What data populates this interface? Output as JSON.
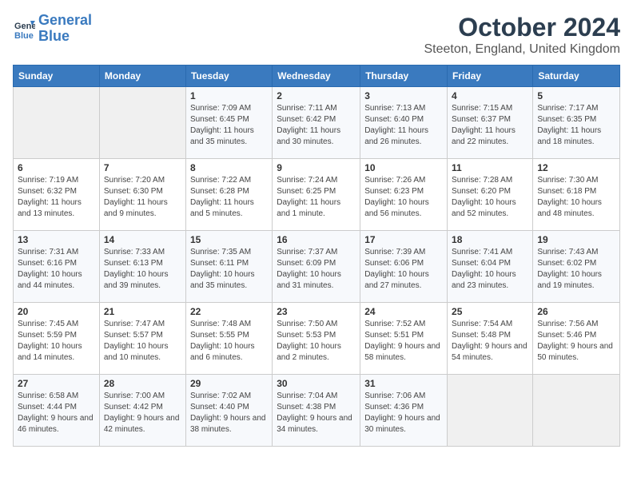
{
  "header": {
    "logo_line1": "General",
    "logo_line2": "Blue",
    "month_title": "October 2024",
    "subtitle": "Steeton, England, United Kingdom"
  },
  "days_of_week": [
    "Sunday",
    "Monday",
    "Tuesday",
    "Wednesday",
    "Thursday",
    "Friday",
    "Saturday"
  ],
  "weeks": [
    [
      {
        "day": "",
        "info": ""
      },
      {
        "day": "",
        "info": ""
      },
      {
        "day": "1",
        "info": "Sunrise: 7:09 AM\nSunset: 6:45 PM\nDaylight: 11 hours and 35 minutes."
      },
      {
        "day": "2",
        "info": "Sunrise: 7:11 AM\nSunset: 6:42 PM\nDaylight: 11 hours and 30 minutes."
      },
      {
        "day": "3",
        "info": "Sunrise: 7:13 AM\nSunset: 6:40 PM\nDaylight: 11 hours and 26 minutes."
      },
      {
        "day": "4",
        "info": "Sunrise: 7:15 AM\nSunset: 6:37 PM\nDaylight: 11 hours and 22 minutes."
      },
      {
        "day": "5",
        "info": "Sunrise: 7:17 AM\nSunset: 6:35 PM\nDaylight: 11 hours and 18 minutes."
      }
    ],
    [
      {
        "day": "6",
        "info": "Sunrise: 7:19 AM\nSunset: 6:32 PM\nDaylight: 11 hours and 13 minutes."
      },
      {
        "day": "7",
        "info": "Sunrise: 7:20 AM\nSunset: 6:30 PM\nDaylight: 11 hours and 9 minutes."
      },
      {
        "day": "8",
        "info": "Sunrise: 7:22 AM\nSunset: 6:28 PM\nDaylight: 11 hours and 5 minutes."
      },
      {
        "day": "9",
        "info": "Sunrise: 7:24 AM\nSunset: 6:25 PM\nDaylight: 11 hours and 1 minute."
      },
      {
        "day": "10",
        "info": "Sunrise: 7:26 AM\nSunset: 6:23 PM\nDaylight: 10 hours and 56 minutes."
      },
      {
        "day": "11",
        "info": "Sunrise: 7:28 AM\nSunset: 6:20 PM\nDaylight: 10 hours and 52 minutes."
      },
      {
        "day": "12",
        "info": "Sunrise: 7:30 AM\nSunset: 6:18 PM\nDaylight: 10 hours and 48 minutes."
      }
    ],
    [
      {
        "day": "13",
        "info": "Sunrise: 7:31 AM\nSunset: 6:16 PM\nDaylight: 10 hours and 44 minutes."
      },
      {
        "day": "14",
        "info": "Sunrise: 7:33 AM\nSunset: 6:13 PM\nDaylight: 10 hours and 39 minutes."
      },
      {
        "day": "15",
        "info": "Sunrise: 7:35 AM\nSunset: 6:11 PM\nDaylight: 10 hours and 35 minutes."
      },
      {
        "day": "16",
        "info": "Sunrise: 7:37 AM\nSunset: 6:09 PM\nDaylight: 10 hours and 31 minutes."
      },
      {
        "day": "17",
        "info": "Sunrise: 7:39 AM\nSunset: 6:06 PM\nDaylight: 10 hours and 27 minutes."
      },
      {
        "day": "18",
        "info": "Sunrise: 7:41 AM\nSunset: 6:04 PM\nDaylight: 10 hours and 23 minutes."
      },
      {
        "day": "19",
        "info": "Sunrise: 7:43 AM\nSunset: 6:02 PM\nDaylight: 10 hours and 19 minutes."
      }
    ],
    [
      {
        "day": "20",
        "info": "Sunrise: 7:45 AM\nSunset: 5:59 PM\nDaylight: 10 hours and 14 minutes."
      },
      {
        "day": "21",
        "info": "Sunrise: 7:47 AM\nSunset: 5:57 PM\nDaylight: 10 hours and 10 minutes."
      },
      {
        "day": "22",
        "info": "Sunrise: 7:48 AM\nSunset: 5:55 PM\nDaylight: 10 hours and 6 minutes."
      },
      {
        "day": "23",
        "info": "Sunrise: 7:50 AM\nSunset: 5:53 PM\nDaylight: 10 hours and 2 minutes."
      },
      {
        "day": "24",
        "info": "Sunrise: 7:52 AM\nSunset: 5:51 PM\nDaylight: 9 hours and 58 minutes."
      },
      {
        "day": "25",
        "info": "Sunrise: 7:54 AM\nSunset: 5:48 PM\nDaylight: 9 hours and 54 minutes."
      },
      {
        "day": "26",
        "info": "Sunrise: 7:56 AM\nSunset: 5:46 PM\nDaylight: 9 hours and 50 minutes."
      }
    ],
    [
      {
        "day": "27",
        "info": "Sunrise: 6:58 AM\nSunset: 4:44 PM\nDaylight: 9 hours and 46 minutes."
      },
      {
        "day": "28",
        "info": "Sunrise: 7:00 AM\nSunset: 4:42 PM\nDaylight: 9 hours and 42 minutes."
      },
      {
        "day": "29",
        "info": "Sunrise: 7:02 AM\nSunset: 4:40 PM\nDaylight: 9 hours and 38 minutes."
      },
      {
        "day": "30",
        "info": "Sunrise: 7:04 AM\nSunset: 4:38 PM\nDaylight: 9 hours and 34 minutes."
      },
      {
        "day": "31",
        "info": "Sunrise: 7:06 AM\nSunset: 4:36 PM\nDaylight: 9 hours and 30 minutes."
      },
      {
        "day": "",
        "info": ""
      },
      {
        "day": "",
        "info": ""
      }
    ]
  ]
}
